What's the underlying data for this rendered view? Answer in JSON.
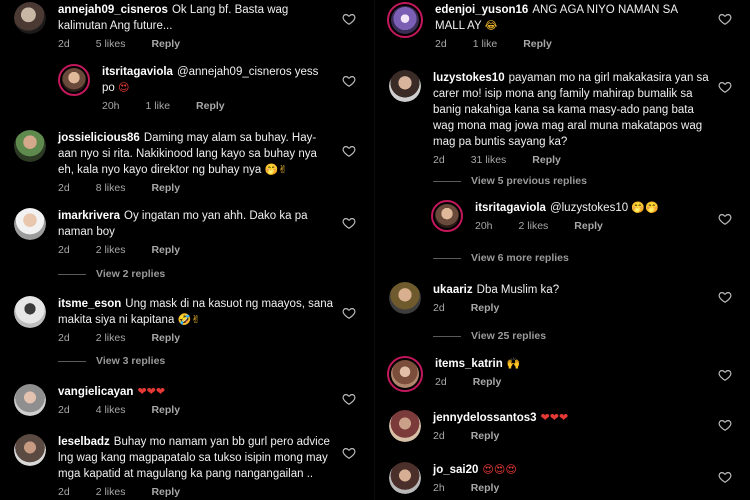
{
  "left": {
    "c1": {
      "username": "annejah09_cisneros",
      "text": "Ok Lang bf. Basta wag kalimutan Ang future...",
      "time": "2d",
      "likes": "5 likes",
      "reply": "Reply"
    },
    "c2": {
      "username": "itsritagaviola",
      "text": "@annejah09_cisneros yess po",
      "emoji": "😍",
      "time": "20h",
      "likes": "1 like",
      "reply": "Reply"
    },
    "c3": {
      "username": "jossielicious86",
      "text": "Daming may alam sa buhay. Hay-aan nyo si rita. Nakikinood lang kayo sa buhay nya eh, kala nyo kayo direktor ng buhay nya",
      "emoji": "🤭✌",
      "time": "2d",
      "likes": "8 likes",
      "reply": "Reply"
    },
    "c4": {
      "username": "imarkrivera",
      "text": "Oy ingatan mo yan ahh. Dako ka pa naman boy",
      "time": "2d",
      "likes": "2 likes",
      "reply": "Reply"
    },
    "v1": "View 2 replies",
    "c5": {
      "username": "itsme_eson",
      "text": "Ung mask di na kasuot ng maayos, sana makita siya ni kapitana",
      "emoji": "🤣✌",
      "time": "2d",
      "likes": "2 likes",
      "reply": "Reply"
    },
    "v2": "View 3 replies",
    "c6": {
      "username": "vangielicayan",
      "emoji": "❤❤❤",
      "time": "2d",
      "likes": "4 likes",
      "reply": "Reply"
    },
    "c7": {
      "username": "leselbadz",
      "text": "Buhay mo namam yan bb gurl pero advice lng wag kang magpapatalo sa tukso isipin mong may mga kapatid at magulang ka pang nangangailan ..",
      "time": "2d",
      "likes": "2 likes",
      "reply": "Reply"
    }
  },
  "right": {
    "c1": {
      "username": "edenjoi_yuson16",
      "text": "ANG AGA NIYO NAMAN SA MALL AY",
      "emoji": "😂",
      "time": "2d",
      "likes": "1 like",
      "reply": "Reply"
    },
    "c2": {
      "username": "luzystokes10",
      "text": "payaman mo na girl makakasira yan sa carer mo! isip mona ang family mahirap bumalik sa banig nakahiga kana sa kama masy-ado pang bata wag mona mag jowa  mag aral muna makatapos wag mag pa buntis sayang ka?",
      "time": "2d",
      "likes": "31 likes",
      "reply": "Reply"
    },
    "v1": "View 5 previous replies",
    "c3": {
      "username": "itsritagaviola",
      "text": "@luzystokes10",
      "emoji": "🤭🤭",
      "time": "20h",
      "likes": "2 likes",
      "reply": "Reply"
    },
    "v2": "View 6 more replies",
    "c4": {
      "username": "ukaariz",
      "text": "Dba Muslim ka?",
      "time": "2d",
      "reply": "Reply"
    },
    "v3": "View 25 replies",
    "c5": {
      "username": "items_katrin",
      "emoji": "🙌",
      "time": "2d",
      "reply": "Reply"
    },
    "c6": {
      "username": "jennydelossantos3",
      "emoji": "❤❤❤",
      "time": "2d",
      "reply": "Reply"
    },
    "c7": {
      "username": "jo_sai20",
      "emoji": "😍😍😍",
      "time": "2h",
      "reply": "Reply"
    }
  },
  "icons": {
    "like": "heart-outline-icon"
  },
  "colors": {
    "background": "#000000",
    "text": "#f0f0f0",
    "meta": "#a8a8a8",
    "heart_emoji": "#e53935",
    "story_ring": "#c2185b"
  }
}
